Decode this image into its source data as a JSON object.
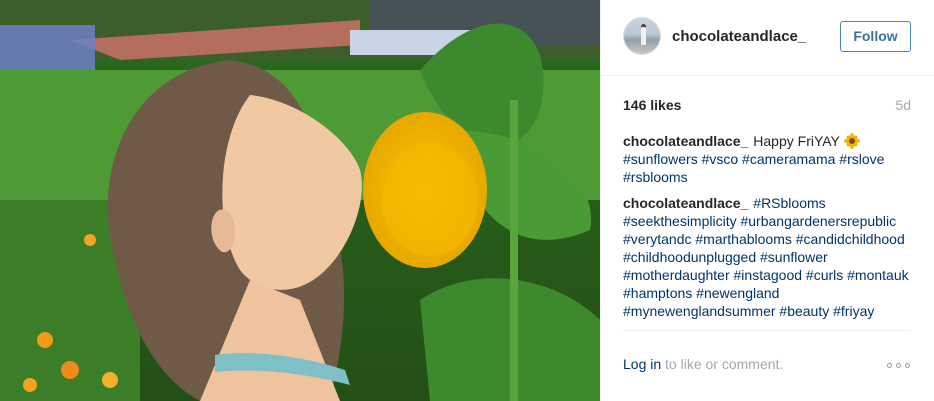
{
  "post": {
    "photo_alt": "Girl smelling a sunflower",
    "username": "chocolateandlace_",
    "follow_label": "Follow",
    "likes": "146 likes",
    "age": "5d",
    "comments": [
      {
        "author": "chocolateandlace_",
        "text": "Happy FriYAY",
        "emoji": "sunflower-icon",
        "tags": "#sunflowers #vsco #cameramama #rslove #rsblooms"
      },
      {
        "author": "chocolateandlace_",
        "text": "",
        "tags": "#RSblooms #seekthesimplicity #urbangardenersrepublic #verytandc #marthablooms #candidchildhood #childhoodunplugged #sunflower #motherdaughter #instagood #curls #montauk #hamptons #newengland #mynewenglandsummer #beauty #friyay"
      }
    ],
    "login_link": "Log in",
    "login_suffix": " to like or comment.",
    "more_icon": "more-options-icon"
  },
  "colors": {
    "link": "#003569",
    "follow": "#3f729b",
    "muted": "#a5a7aa"
  }
}
